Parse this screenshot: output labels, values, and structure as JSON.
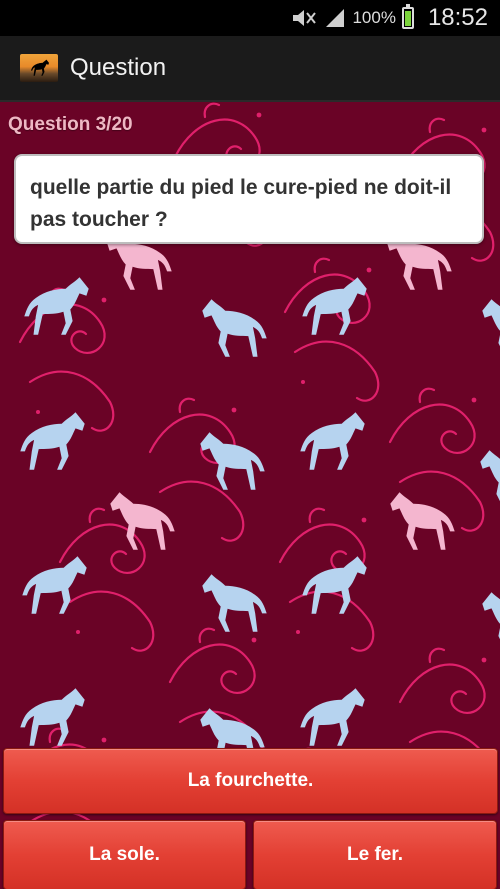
{
  "status_bar": {
    "battery_percent": "100%",
    "time": "18:52",
    "icons": [
      "mute-icon",
      "signal-icon",
      "battery-icon"
    ]
  },
  "action_bar": {
    "title": "Question",
    "icon": "horse-app-icon"
  },
  "quiz": {
    "counter": "Question 3/20",
    "question": "quelle partie du pied le cure-pied ne doit-il pas toucher ?",
    "answers": [
      "La fourchette.",
      "La sole.",
      "Le fer."
    ]
  },
  "colors": {
    "background": "#6a0326",
    "button": "#e34034",
    "horse_blue": "#b6d3ef",
    "horse_pink": "#f4b6cf",
    "swirl": "#e0206b"
  }
}
